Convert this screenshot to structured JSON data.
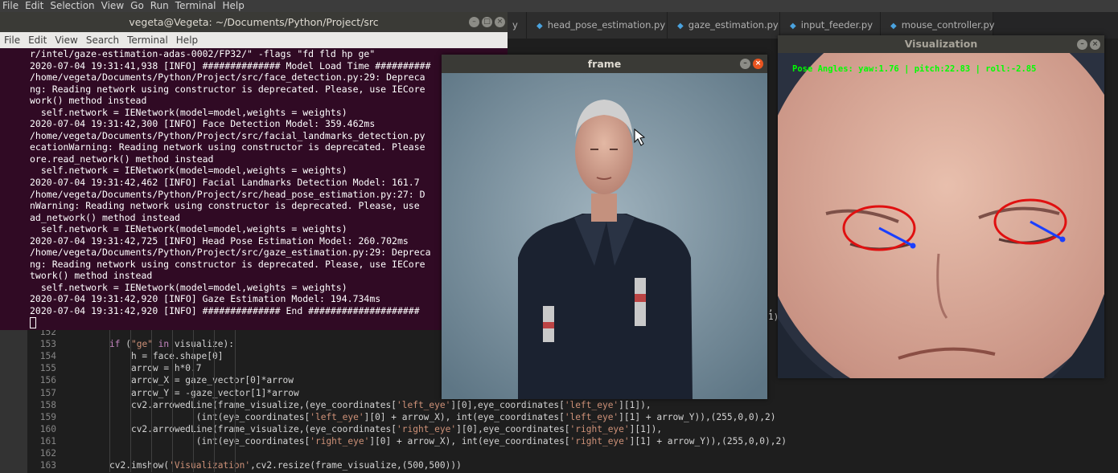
{
  "vscode": {
    "menu": [
      "File",
      "Edit",
      "Selection",
      "View",
      "Go",
      "Run",
      "Terminal",
      "Help"
    ],
    "tabs": [
      {
        "label": "y",
        "icon": "python-file-icon"
      },
      {
        "label": "head_pose_estimation.py",
        "icon": "python-file-icon"
      },
      {
        "label": "gaze_estimation.py",
        "icon": "python-file-icon"
      },
      {
        "label": "input_feeder.py",
        "icon": "python-file-icon"
      },
      {
        "label": "mouse_controller.py",
        "icon": "python-file-icon"
      }
    ],
    "code_lines": [
      {
        "num": "152",
        "indent": 0,
        "text": ""
      },
      {
        "num": "153",
        "indent": 2,
        "text": "if (\"ge\" in visualize):"
      },
      {
        "num": "154",
        "indent": 3,
        "text": "h = face.shape[0]"
      },
      {
        "num": "155",
        "indent": 3,
        "text": "arrow = h*0.7"
      },
      {
        "num": "156",
        "indent": 3,
        "text": "arrow_X = gaze_vector[0]*arrow"
      },
      {
        "num": "157",
        "indent": 3,
        "text": "arrow_Y = -gaze_vector[1]*arrow"
      },
      {
        "num": "158",
        "indent": 3,
        "text": "cv2.arrowedLine(frame_visualize,(eye_coordinates['left_eye'][0],eye_coordinates['left_eye'][1]),"
      },
      {
        "num": "159",
        "indent": 6,
        "text": "(int(eye_coordinates['left_eye'][0] + arrow_X), int(eye_coordinates['left_eye'][1] + arrow_Y)),(255,0,0),2)"
      },
      {
        "num": "160",
        "indent": 3,
        "text": "cv2.arrowedLine(frame_visualize,(eye_coordinates['right_eye'][0],eye_coordinates['right_eye'][1]),"
      },
      {
        "num": "161",
        "indent": 6,
        "text": "(int(eye_coordinates['right_eye'][0] + arrow_X), int(eye_coordinates['right_eye'][1] + arrow_Y)),(255,0,0),2)"
      },
      {
        "num": "162",
        "indent": 0,
        "text": ""
      },
      {
        "num": "163",
        "indent": 2,
        "text": "cv2.imshow('Visualization',cv2.resize(frame_visualize,(500,500)))"
      }
    ],
    "right_fragments": [
      ",",
      "1)"
    ]
  },
  "terminal": {
    "title": "vegeta@Vegeta: ~/Documents/Python/Project/src",
    "menu": [
      "File",
      "Edit",
      "View",
      "Search",
      "Terminal",
      "Help"
    ],
    "lines": [
      "r/intel/gaze-estimation-adas-0002/FP32/\" -flags \"fd fld hp ge\"",
      "2020-07-04 19:31:41,938 [INFO] ############## Model Load Time ##########",
      "/home/vegeta/Documents/Python/Project/src/face_detection.py:29: Depreca",
      "ng: Reading network using constructor is deprecated. Please, use IECore",
      "work() method instead",
      "  self.network = IENetwork(model=model,weights = weights)",
      "2020-07-04 19:31:42,300 [INFO] Face Detection Model: 359.462ms",
      "/home/vegeta/Documents/Python/Project/src/facial_landmarks_detection.py",
      "ecationWarning: Reading network using constructor is deprecated. Please",
      "ore.read_network() method instead",
      "  self.network = IENetwork(model=model,weights = weights)",
      "2020-07-04 19:31:42,462 [INFO] Facial Landmarks Detection Model: 161.7",
      "/home/vegeta/Documents/Python/Project/src/head_pose_estimation.py:27: D",
      "nWarning: Reading network using constructor is deprecated. Please, use",
      "ad_network() method instead",
      "  self.network = IENetwork(model=model,weights = weights)",
      "2020-07-04 19:31:42,725 [INFO] Head Pose Estimation Model: 260.702ms",
      "/home/vegeta/Documents/Python/Project/src/gaze_estimation.py:29: Depreca",
      "ng: Reading network using constructor is deprecated. Please, use IECore",
      "twork() method instead",
      "  self.network = IENetwork(model=model,weights = weights)",
      "2020-07-04 19:31:42,920 [INFO] Gaze Estimation Model: 194.734ms",
      "2020-07-04 19:31:42,920 [INFO] ############## End ####################"
    ]
  },
  "frame_window": {
    "title": "frame",
    "image_subject": "man standing against a blue backdrop"
  },
  "viz_window": {
    "title": "Visualization",
    "overlay_text": "Pose Angles: yaw:1.76 | pitch:22.83 | roll:-2.85"
  },
  "colors": {
    "terminal_bg": "#300a24",
    "editor_bg": "#1e1e1e",
    "eye_circle": "#e01010",
    "gaze_arrow": "#1a3fff",
    "overlay_text": "#00ff00"
  }
}
